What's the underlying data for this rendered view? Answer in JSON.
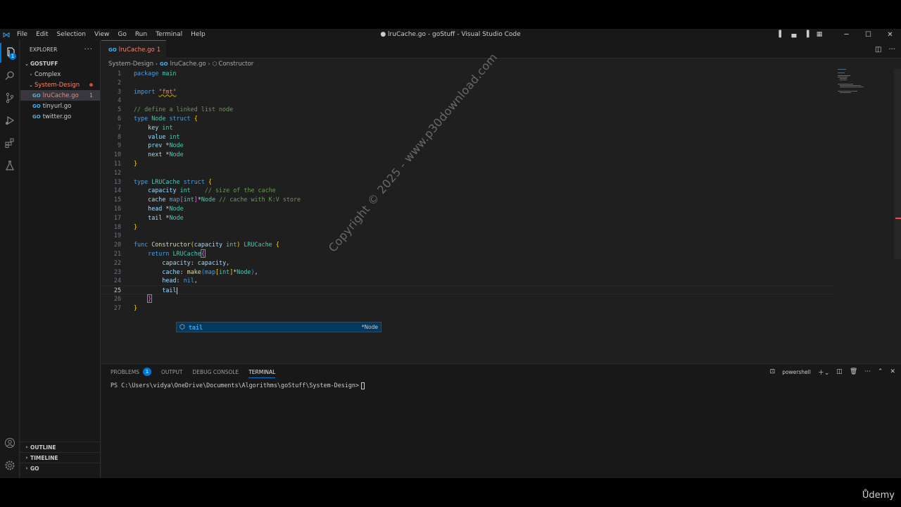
{
  "titlebar": {
    "menu": [
      "File",
      "Edit",
      "Selection",
      "View",
      "Go",
      "Run",
      "Terminal",
      "Help"
    ],
    "title": "● lruCache.go - goStuff - Visual Studio Code"
  },
  "activity": {
    "explorer_badge": "1"
  },
  "sidebar": {
    "title": "EXPLORER",
    "root": "GOSTUFF",
    "items": [
      {
        "label": "Complex",
        "type": "folder"
      },
      {
        "label": "System-Design",
        "type": "folder"
      },
      {
        "label": "lruCache.go",
        "type": "file",
        "errors": "1"
      },
      {
        "label": "tinyurl.go",
        "type": "file"
      },
      {
        "label": "twitter.go",
        "type": "file"
      }
    ],
    "sections": [
      "OUTLINE",
      "TIMELINE",
      "GO"
    ]
  },
  "tab": {
    "name": "lruCache.go",
    "errors": "1"
  },
  "breadcrumb": {
    "folder": "System-Design",
    "file": "lruCache.go",
    "symbol": "Constructor"
  },
  "code": {
    "line_numbers": [
      "1",
      "2",
      "3",
      "4",
      "5",
      "6",
      "7",
      "8",
      "9",
      "10",
      "11",
      "12",
      "13",
      "14",
      "15",
      "16",
      "17",
      "18",
      "19",
      "20",
      "21",
      "22",
      "23",
      "24",
      "25",
      "26",
      "27"
    ],
    "t": {
      "package": "package",
      "main": "main",
      "import": "import",
      "fmt": "\"fmt\"",
      "c1": "// define a linked list node",
      "type": "type",
      "Node": "Node",
      "struct": "struct",
      "ob": "{",
      "cb": "}",
      "key": "key",
      "value": "value",
      "prev": "prev",
      "next": "next",
      "int": "int",
      "star": "*",
      "LRUCache": "LRUCache",
      "capacity": "capacity",
      "c2": "// size of the cache",
      "cache": "cache",
      "map": "map",
      "lb": "[",
      "rb": "]",
      "c3": "// cache with K:V store",
      "head": "head",
      "tail": "tail",
      "func": "func",
      "Constructor": "Constructor",
      "op": "(",
      "cp": ")",
      "return": "return",
      "colon": ":",
      "comma": ",",
      "make": "make",
      "nil": "nil",
      "sp": " "
    }
  },
  "suggest": {
    "label": "tail",
    "detail": "*Node"
  },
  "panel": {
    "tabs": [
      "PROBLEMS",
      "OUTPUT",
      "DEBUG CONSOLE",
      "TERMINAL"
    ],
    "problems_count": "1",
    "shell": "powershell",
    "prompt": "PS C:\\Users\\vidya\\OneDrive\\Documents\\Algorithms\\goStuff\\System-Design>"
  },
  "watermark": "Copyright © 2025 - www.p30download.com",
  "brand": "Ůdemy"
}
